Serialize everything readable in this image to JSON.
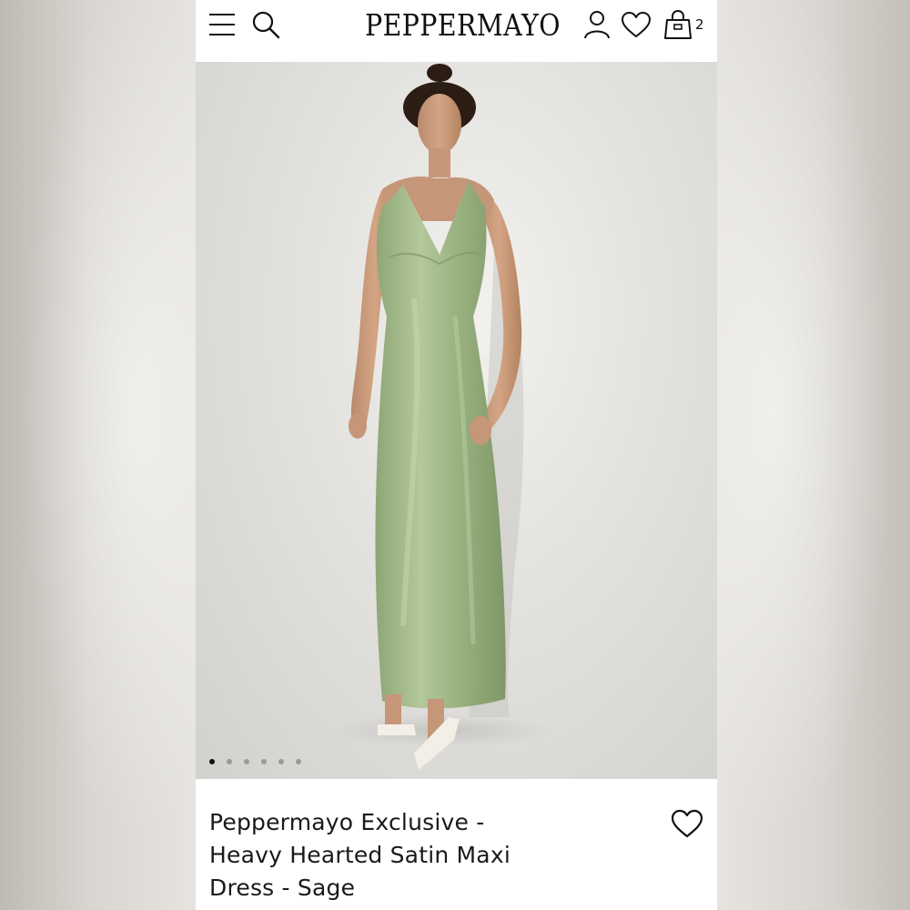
{
  "header": {
    "logo": "PEPPERMAYO",
    "bag_count": "2",
    "icons": [
      "menu-icon",
      "search-icon",
      "account-icon",
      "heart-icon",
      "bag-icon"
    ]
  },
  "gallery": {
    "image": "model wearing sage satin halter maxi dress",
    "total_slides": 6,
    "active_slide": 1
  },
  "product": {
    "title_lines": [
      "Peppermayo Exclusive -",
      "Heavy Hearted Satin Maxi",
      "Dress - Sage"
    ]
  },
  "colors": {
    "dress": "#9db584",
    "text": "#111111",
    "backdrop": "#e4e3e0"
  }
}
